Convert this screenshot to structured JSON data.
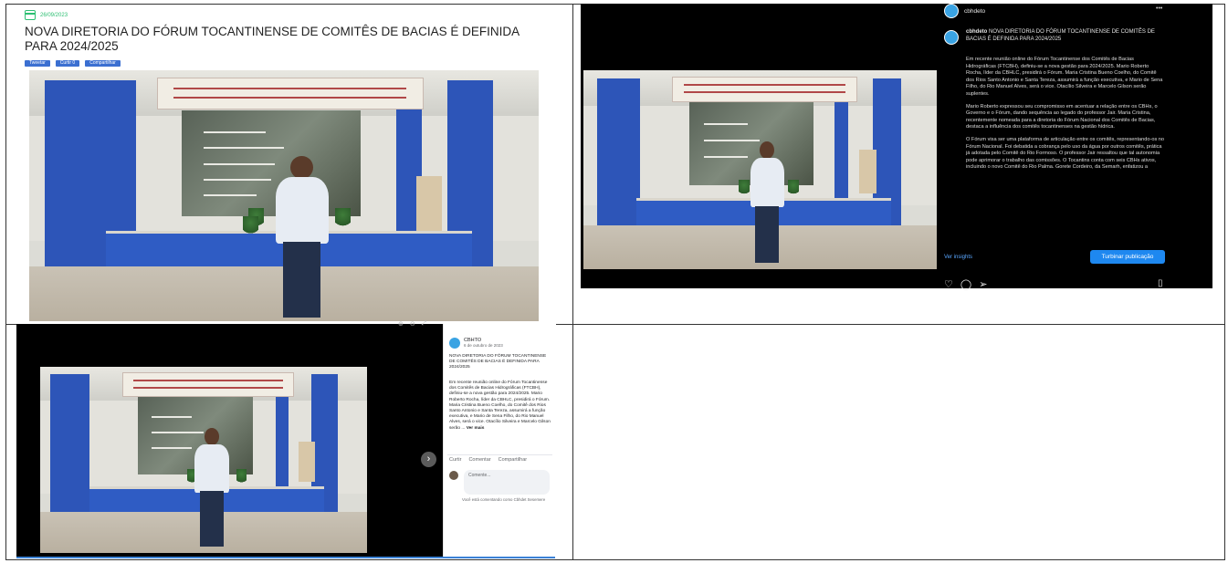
{
  "article": {
    "date": "26/09/2023",
    "title": "NOVA DIRETORIA DO FÓRUM TOCANTINENSE DE COMITÊS DE BACIAS É DEFINIDA PARA 2024/2025",
    "share_buttons": [
      "Tweetar",
      "Curtir 0",
      "Compartilhar"
    ]
  },
  "instagram": {
    "username": "cbhdeto",
    "caption": "NOVA DIRETORIA DO FÓRUM TOCANTINENSE DE COMITÊS DE BACIAS É DEFINIDA PARA 2024/2025",
    "paragraphs": [
      "Em recente reunião online do Fórum Tocantinense dos Comitês de Bacias Hidrográficas (FTCBH), definiu-se a nova gestão para 2024/2025. Mario Roberto Rocha, líder da CBHLC, presidirá o Fórum. Maria Cristina Bueno Coelho, do Comitê dos Rios Santo Antonio e Santa Tereza, assumirá a função executiva, e Mario de Sena Filho, do Rio Manuel Alves, será o vice. Otacílio Silveira e Marcelo Gilson serão suplentes.",
      "Mario Roberto expressou seu compromisso em acentuar a relação entre os CBHs, o Governo e o Fórum, dando sequência ao legado do professor Jair. Maria Cristina, recentemente nomeada para a diretoria do Fórum Nacional dos Comitês de Bacias, destaca a influência dos comitês tocantinenses na gestão hídrica.",
      "O Fórum visa ser uma plataforma de articulação entre os comitês, representando-os no Fórum Nacional. Foi debatida a cobrança pelo uso da água por outros comitês, prática já adotada pelo Comitê do Rio Formoso. O professor Jair ressaltou que tal autonomia pode aprimorar o trabalho das comissões. O Tocantins conta com seis CBHs ativos, incluindo o novo Comitê do Rio Palma. Gorete Cordeiro, da Semarh, enfatizou a"
    ],
    "insights_link": "Ver insights",
    "boost_button": "Turbinar publicação"
  },
  "facebook": {
    "page_name": "CBHTO",
    "time": "6 de outubro de 2023",
    "title": "NOVA DIRETORIA DO FÓRUM TOCANTINENSE DE COMITÊS DE BACIAS É DEFINIDA PARA 2024/2025",
    "text": "Em recente reunião online do Fórum Tocantinense dos Comitês de Bacias Hidrográficas (FTCBH), definiu-se a nova gestão para 2024/2025. Mario Roberto Rocha, líder da CBHLC, presidirá o Fórum. Maria Cristina Bueno Coelho, do Comitê dos Rios Santo Antonio e Santa Tereza, assumirá a função executiva, e Mario de Sena Filho, do Rio Manuel Alves, será o vice. Otacílio Silveira e Marcelo Gilson serão ...",
    "see_more": "Ver mais",
    "actions": [
      "Curtir",
      "Comentar",
      "Compartilhar"
    ],
    "comment_placeholder": "Comente...",
    "notice": "Você está comentando como Cbhdet Sesemere"
  },
  "colors": {
    "accent_green": "#2dbf72",
    "share_blue": "#3b6fd1",
    "boost_blue": "#1e88f0",
    "wall_blue": "#2d55b8"
  }
}
